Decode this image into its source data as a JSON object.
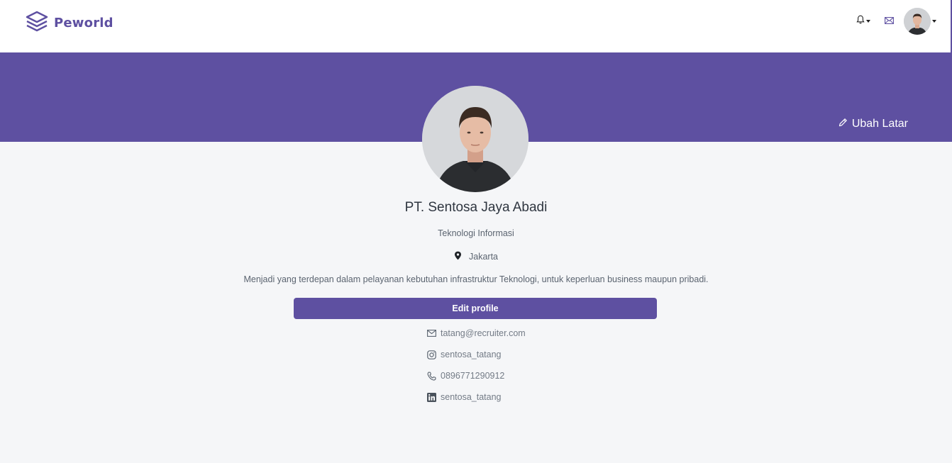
{
  "brand": {
    "name": "Peworld",
    "color": "#5e50a1"
  },
  "nav": {
    "notification_icon": "bell-icon",
    "mail_icon": "mail-icon",
    "avatar_icon": "user-avatar"
  },
  "banner": {
    "change_background_label": "Ubah Latar",
    "color": "#5e50a1"
  },
  "profile": {
    "company_name": "PT. Sentosa Jaya Abadi",
    "field": "Teknologi Informasi",
    "location": "Jakarta",
    "description": "Menjadi yang terdepan dalam pelayanan kebutuhan infrastruktur Teknologi, untuk keperluan business maupun pribadi.",
    "edit_button_label": "Edit profile"
  },
  "contacts": [
    {
      "icon": "mail-icon",
      "value": "tatang@recruiter.com"
    },
    {
      "icon": "instagram-icon",
      "value": "sentosa_tatang"
    },
    {
      "icon": "phone-icon",
      "value": "0896771290912"
    },
    {
      "icon": "linkedin-icon",
      "value": "sentosa_tatang"
    }
  ]
}
